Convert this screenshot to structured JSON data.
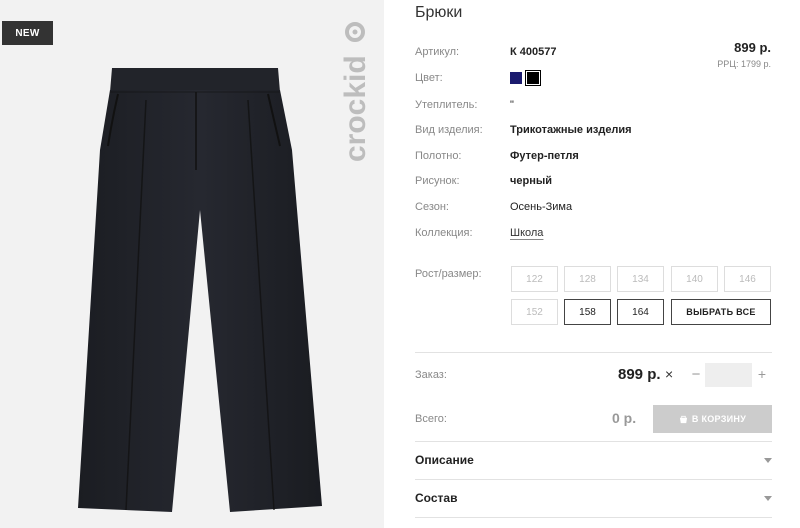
{
  "badge": "NEW",
  "brand_logo_text": "crockid",
  "product": {
    "title": "Брюки",
    "price": "899 р.",
    "rrp": "РРЦ: 1799 р."
  },
  "specs": {
    "article_label": "Артикул:",
    "article_value": "К 400577",
    "color_label": "Цвет:",
    "colors": [
      "#1a1a6e",
      "#000000"
    ],
    "insulation_label": "Утеплитель:",
    "insulation_value": "\"",
    "type_label": "Вид изделия:",
    "type_value": "Трикотажные изделия",
    "fabric_label": "Полотно:",
    "fabric_value": "Футер-петля",
    "pattern_label": "Рисунок:",
    "pattern_value": "черный",
    "season_label": "Сезон:",
    "season_value": "Осень-Зима",
    "collection_label": "Коллекция:",
    "collection_value": "Школа"
  },
  "sizes": {
    "label": "Рост/размер:",
    "items": [
      {
        "label": "122",
        "available": false
      },
      {
        "label": "128",
        "available": false
      },
      {
        "label": "134",
        "available": false
      },
      {
        "label": "140",
        "available": false
      },
      {
        "label": "146",
        "available": false
      },
      {
        "label": "152",
        "available": false
      },
      {
        "label": "158",
        "available": true
      },
      {
        "label": "164",
        "available": true
      }
    ],
    "select_all": "ВЫБРАТЬ ВСЕ"
  },
  "order": {
    "label": "Заказ:",
    "price": "899 р.",
    "times": "×",
    "minus": "−",
    "plus": "+",
    "quantity": ""
  },
  "total": {
    "label": "Всего:",
    "value": "0 р.",
    "cart_button": "В КОРЗИНУ"
  },
  "accordion": {
    "description": "Описание",
    "composition": "Состав"
  }
}
